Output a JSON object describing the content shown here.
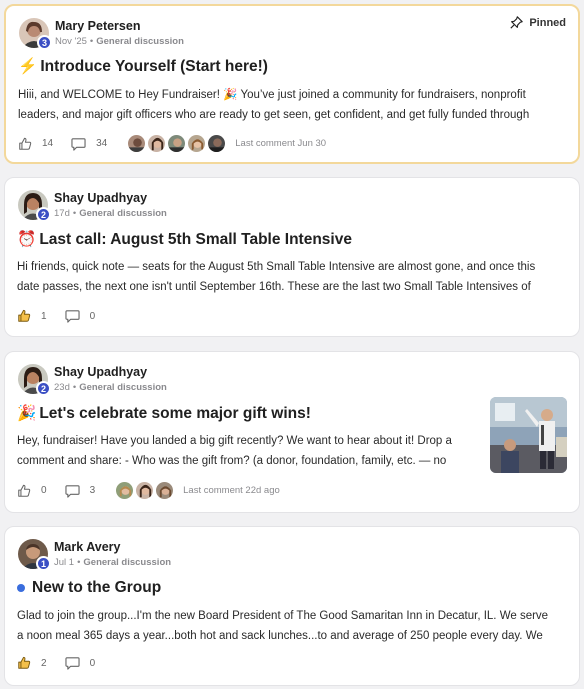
{
  "posts": [
    {
      "author": "Mary Petersen",
      "level": "3",
      "date": "Nov '25",
      "category": "General discussion",
      "pinned_label": "Pinned",
      "title_emoji": "⚡",
      "title": "Introduce Yourself (Start here!)",
      "body_lines": [
        "Hiii, and WELCOME to Hey Fundraiser! 🎉 You’ve just joined a community for fundraisers, nonprofit",
        "leaders, and major gift officers who are ready to get seen, get confident, and get fully funded through"
      ],
      "likes": "14",
      "comments": "34",
      "last_comment": "Last comment Jun 30"
    },
    {
      "author": "Shay Upadhyay",
      "level": "2",
      "date": "17d",
      "category": "General discussion",
      "title_emoji": "⏰",
      "title": "Last call: August 5th Small Table Intensive",
      "body_lines": [
        "Hi friends, quick note — seats for the August 5th Small Table Intensive are almost gone, and once this",
        "date passes, the next one isn't until September 16th. These are the last two Small Table Intensives of"
      ],
      "likes": "1",
      "comments": "0"
    },
    {
      "author": "Shay Upadhyay",
      "level": "2",
      "date": "23d",
      "category": "General discussion",
      "title_emoji": "🎉",
      "title": "Let's celebrate some major gift wins!",
      "body_lines": [
        "Hey, fundraiser! Have you landed a big gift recently? We want to hear about it! Drop a",
        "comment and share: - Who was the gift from? (a donor, foundation, family, etc. — no"
      ],
      "likes": "0",
      "comments": "3",
      "last_comment": "Last comment 22d ago"
    },
    {
      "author": "Mark Avery",
      "level": "1",
      "date": "Jul 1",
      "category": "General discussion",
      "title": "New to the Group",
      "body_lines": [
        "Glad to join the group...I'm the new Board President of The Good Samaritan Inn in Decatur, IL. We serve",
        "a noon meal 365 days a year...both hot and sack lunches...to and average of 250 people every day. We"
      ],
      "likes": "2",
      "comments": "0"
    }
  ],
  "icons": {
    "like": "thumbs-up-icon",
    "comment": "comment-bubble-icon",
    "pin": "pin-icon",
    "new_dot": "blue-dot-icon"
  },
  "colors": {
    "pinned_border": "#f3d89b",
    "level_badge": "#3b4fc4",
    "new_dot": "#3a6ddd",
    "liked_thumb": "#e8a424"
  }
}
